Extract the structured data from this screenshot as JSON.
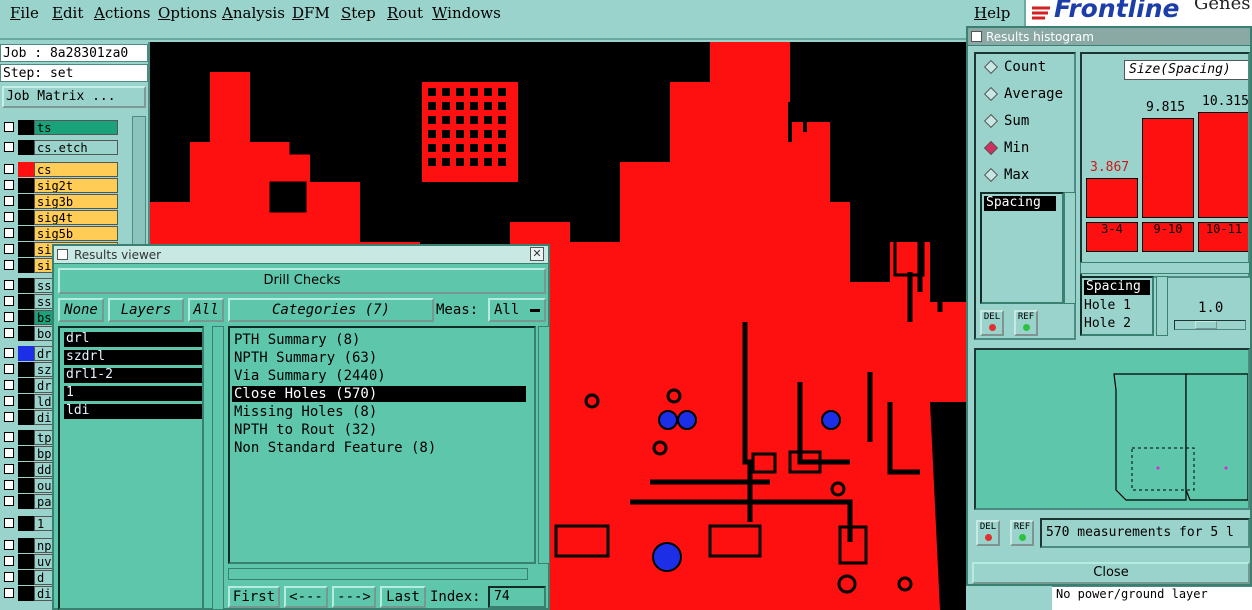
{
  "menubar": {
    "items": [
      "File",
      "Edit",
      "Actions",
      "Options",
      "Analysis",
      "DFM",
      "Step",
      "Rout",
      "Windows"
    ],
    "help": "Help",
    "brand": "Frontline",
    "brand_extra": "Genes"
  },
  "left_panel": {
    "job": "Job : 8a28301za0",
    "step": "Step: set",
    "job_matrix_button": "Job Matrix ...",
    "layers": [
      {
        "name": "ts",
        "color": "#1aa37a"
      },
      {
        "name": "cs.etch",
        "color": "#9ad3cc"
      },
      {
        "name": "cs",
        "color": "#ffcc55"
      },
      {
        "name": "sig2t",
        "color": "#ffcc55"
      },
      {
        "name": "sig3b",
        "color": "#ffcc55"
      },
      {
        "name": "sig4t",
        "color": "#ffcc55"
      },
      {
        "name": "sig5b",
        "color": "#ffcc55"
      },
      {
        "name": "si",
        "color": "#ffcc55"
      },
      {
        "name": "si",
        "color": "#ffcc55"
      },
      {
        "name": "ss",
        "color": "#9ad3cc"
      },
      {
        "name": "ss",
        "color": "#9ad3cc"
      },
      {
        "name": "bs",
        "color": "#1aa37a"
      },
      {
        "name": "bo",
        "color": "#9ad3cc"
      },
      {
        "name": "dr",
        "color": "#9ad3cc"
      },
      {
        "name": "sz",
        "color": "#9ad3cc"
      },
      {
        "name": "dr",
        "color": "#9ad3cc"
      },
      {
        "name": "ld",
        "color": "#9ad3cc"
      },
      {
        "name": "di",
        "color": "#9ad3cc"
      },
      {
        "name": "tp",
        "color": "#9ad3cc"
      },
      {
        "name": "bp",
        "color": "#9ad3cc"
      },
      {
        "name": "dd",
        "color": "#9ad3cc"
      },
      {
        "name": "ou",
        "color": "#9ad3cc"
      },
      {
        "name": "pa",
        "color": "#9ad3cc"
      },
      {
        "name": "1",
        "color": "#9ad3cc"
      },
      {
        "name": "np",
        "color": "#9ad3cc"
      },
      {
        "name": "uv",
        "color": "#9ad3cc"
      },
      {
        "name": "d",
        "color": "#9ad3cc"
      },
      {
        "name": "di",
        "color": "#9ad3cc"
      }
    ]
  },
  "results_viewer": {
    "title": "Results viewer",
    "header": "Drill Checks",
    "none_button": "None",
    "layers_button": "Layers",
    "all_button": "All",
    "categories_button": "Categories (7)",
    "meas_label": "Meas:",
    "meas_value": "All",
    "layers": [
      "drl",
      "szdrl",
      "drl1-2",
      "1",
      "ldi"
    ],
    "categories": [
      "PTH Summary (8)",
      "NPTH Summary (63)",
      "Via Summary (2440)",
      "Close Holes (570)",
      "Missing Holes (8)",
      "NPTH to Rout (32)",
      "Non Standard Feature (8)"
    ],
    "selected_category": "Close Holes (570)",
    "nav": {
      "first": "First",
      "prev": "<---",
      "next": "--->",
      "last": "Last",
      "index_label": "Index:",
      "index_value": "74"
    }
  },
  "results_histogram": {
    "title": "Results histogram",
    "modes": [
      "Count",
      "Average",
      "Sum",
      "Min",
      "Max"
    ],
    "selected_mode": "Min",
    "axis_field": "Size(Spacing)",
    "bars": [
      {
        "category": "3-4",
        "value": "3.867",
        "level": 0.33
      },
      {
        "category": "9-10",
        "value": "9.815",
        "level": 0.83
      },
      {
        "category": "10-11",
        "value": "10.315",
        "level": 0.88
      }
    ],
    "field_list": [
      "Spacing"
    ],
    "attribute_list": [
      "Spacing",
      "Hole 1",
      "Hole 2"
    ],
    "slider_value": "1.0",
    "del_label": "DEL",
    "ref_label": "REF",
    "status": "570 measurements for 5 l",
    "close_button": "Close",
    "bottom_text": "No power/ground layer"
  }
}
